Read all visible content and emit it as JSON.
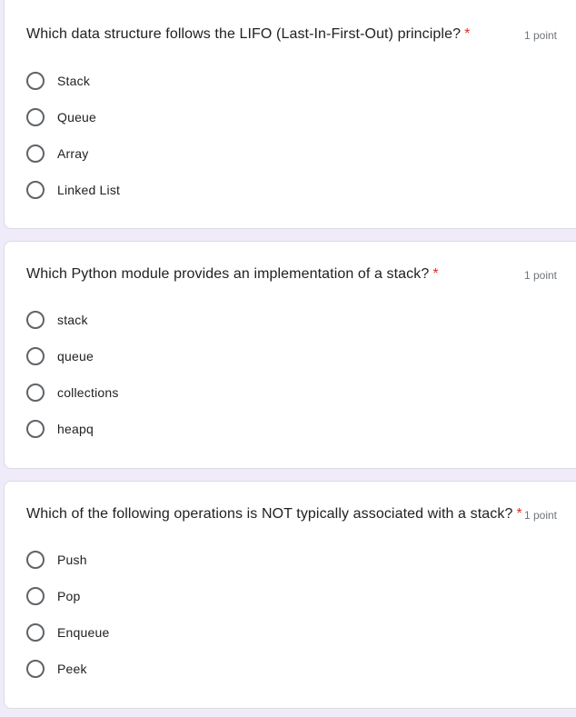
{
  "questions": [
    {
      "title": "Which data structure follows the LIFO (Last-In-First-Out) principle?",
      "required_mark": "*",
      "points": "1 point",
      "options": [
        "Stack",
        "Queue",
        "Array",
        "Linked List"
      ]
    },
    {
      "title": "Which Python module provides an implementation of a stack?",
      "required_mark": "*",
      "points": "1 point",
      "options": [
        "stack",
        "queue",
        "collections",
        "heapq"
      ]
    },
    {
      "title": "Which of the following operations is NOT typically associated with a stack?",
      "required_mark": "*",
      "points": "1 point",
      "options": [
        "Push",
        "Pop",
        "Enqueue",
        "Peek"
      ]
    }
  ],
  "colors": {
    "background": "#f0ebf8",
    "card": "#ffffff",
    "required": "#d93025",
    "radio_border": "#5f6368",
    "points_text": "#70757a"
  }
}
